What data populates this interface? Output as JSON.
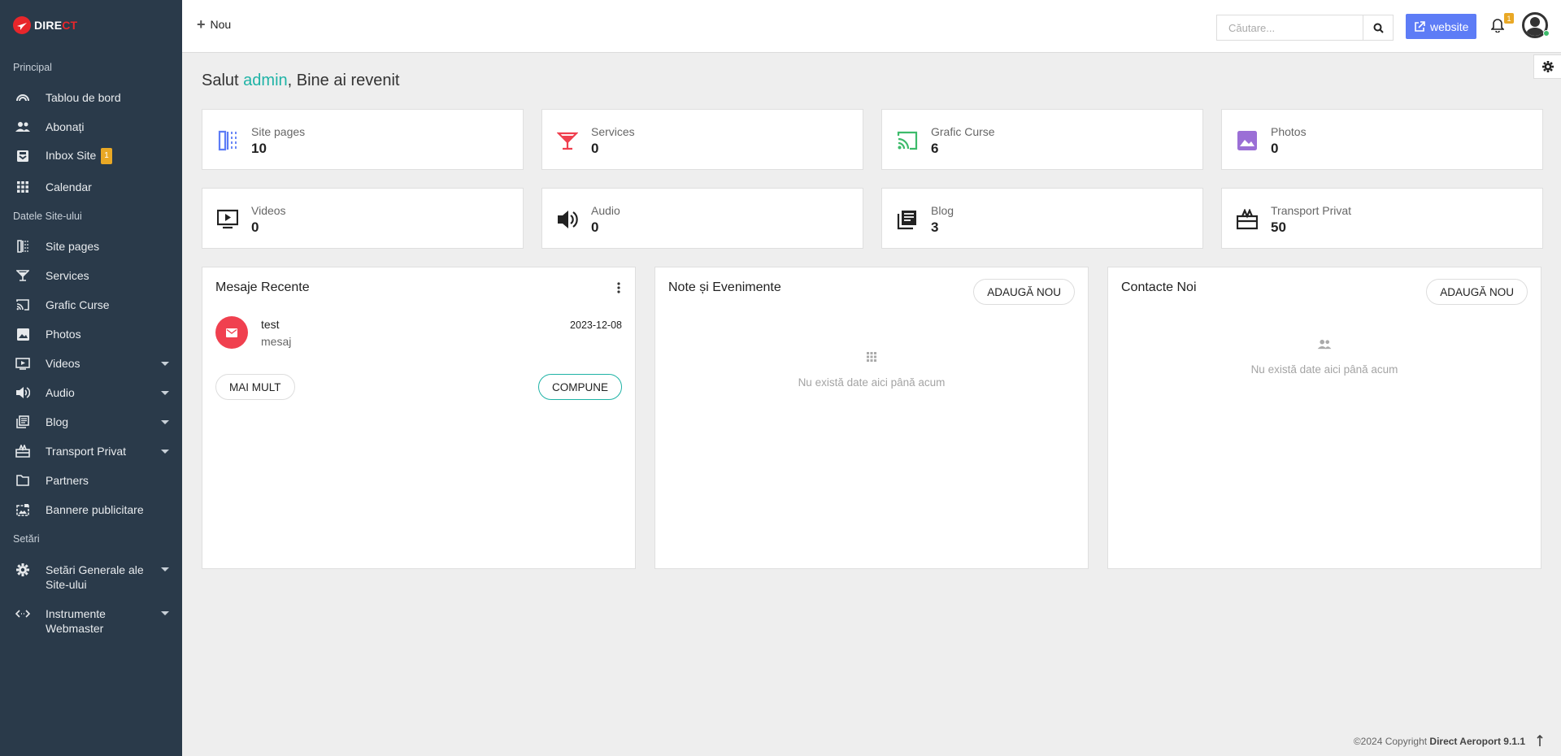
{
  "sidebar": {
    "logo": {
      "text_white": "DIRE",
      "text_red": "CT"
    },
    "sections": {
      "principal": "Principal",
      "site_data": "Datele Site-ului",
      "settings": "Setări"
    },
    "items": [
      {
        "label": "Tablou de bord",
        "icon": "dashboard-icon"
      },
      {
        "label": "Abonați",
        "icon": "users-icon"
      },
      {
        "label": "Inbox Site",
        "icon": "inbox-icon",
        "badge": "1"
      },
      {
        "label": "Calendar",
        "icon": "calendar-icon"
      },
      {
        "label": "Site pages",
        "icon": "pages-icon"
      },
      {
        "label": "Services",
        "icon": "cocktail-icon"
      },
      {
        "label": "Grafic Curse",
        "icon": "cast-icon"
      },
      {
        "label": "Photos",
        "icon": "photo-icon"
      },
      {
        "label": "Videos",
        "icon": "video-icon"
      },
      {
        "label": "Audio",
        "icon": "audio-icon"
      },
      {
        "label": "Blog",
        "icon": "blog-icon"
      },
      {
        "label": "Transport Privat",
        "icon": "transport-icon"
      },
      {
        "label": "Partners",
        "icon": "folder-icon"
      },
      {
        "label": "Bannere publicitare",
        "icon": "banner-icon"
      },
      {
        "label_l1": "Setări Generale ale",
        "label_l2": "Site-ului",
        "icon": "gear-icon"
      },
      {
        "label_l1": "Instrumente",
        "label_l2": "Webmaster",
        "icon": "code-icon"
      }
    ]
  },
  "topbar": {
    "new_label": "Nou",
    "search_placeholder": "Căutare...",
    "website_label": "website",
    "notification_count": "1"
  },
  "greeting": {
    "prefix": "Salut ",
    "user": "admin",
    "suffix": ", Bine ai revenit"
  },
  "stats": [
    {
      "label": "Site pages",
      "value": "10",
      "color": "#5d7cf6"
    },
    {
      "label": "Services",
      "value": "0",
      "color": "#f0404f"
    },
    {
      "label": "Grafic Curse",
      "value": "6",
      "color": "#3dbb6b"
    },
    {
      "label": "Photos",
      "value": "0",
      "color": "#9b6fd6"
    },
    {
      "label": "Videos",
      "value": "0",
      "color": "#222222"
    },
    {
      "label": "Audio",
      "value": "0",
      "color": "#222222"
    },
    {
      "label": "Blog",
      "value": "3",
      "color": "#222222"
    },
    {
      "label": "Transport Privat",
      "value": "50",
      "color": "#222222"
    }
  ],
  "panels": {
    "messages": {
      "title": "Mesaje Recente",
      "item": {
        "name": "test",
        "text": "mesaj",
        "date": "2023-12-08"
      },
      "more_label": "MAI MULT",
      "compose_label": "COMPUNE"
    },
    "notes": {
      "title": "Note și Evenimente",
      "add_label": "ADAUGĂ NOU",
      "empty": "Nu există date aici până acum"
    },
    "contacts": {
      "title": "Contacte Noi",
      "add_label": "ADAUGĂ NOU",
      "empty": "Nu există date aici până acum"
    }
  },
  "footer": {
    "copyright": "©2024 Copyright ",
    "brand": "Direct Aeroport 9.1.1"
  }
}
